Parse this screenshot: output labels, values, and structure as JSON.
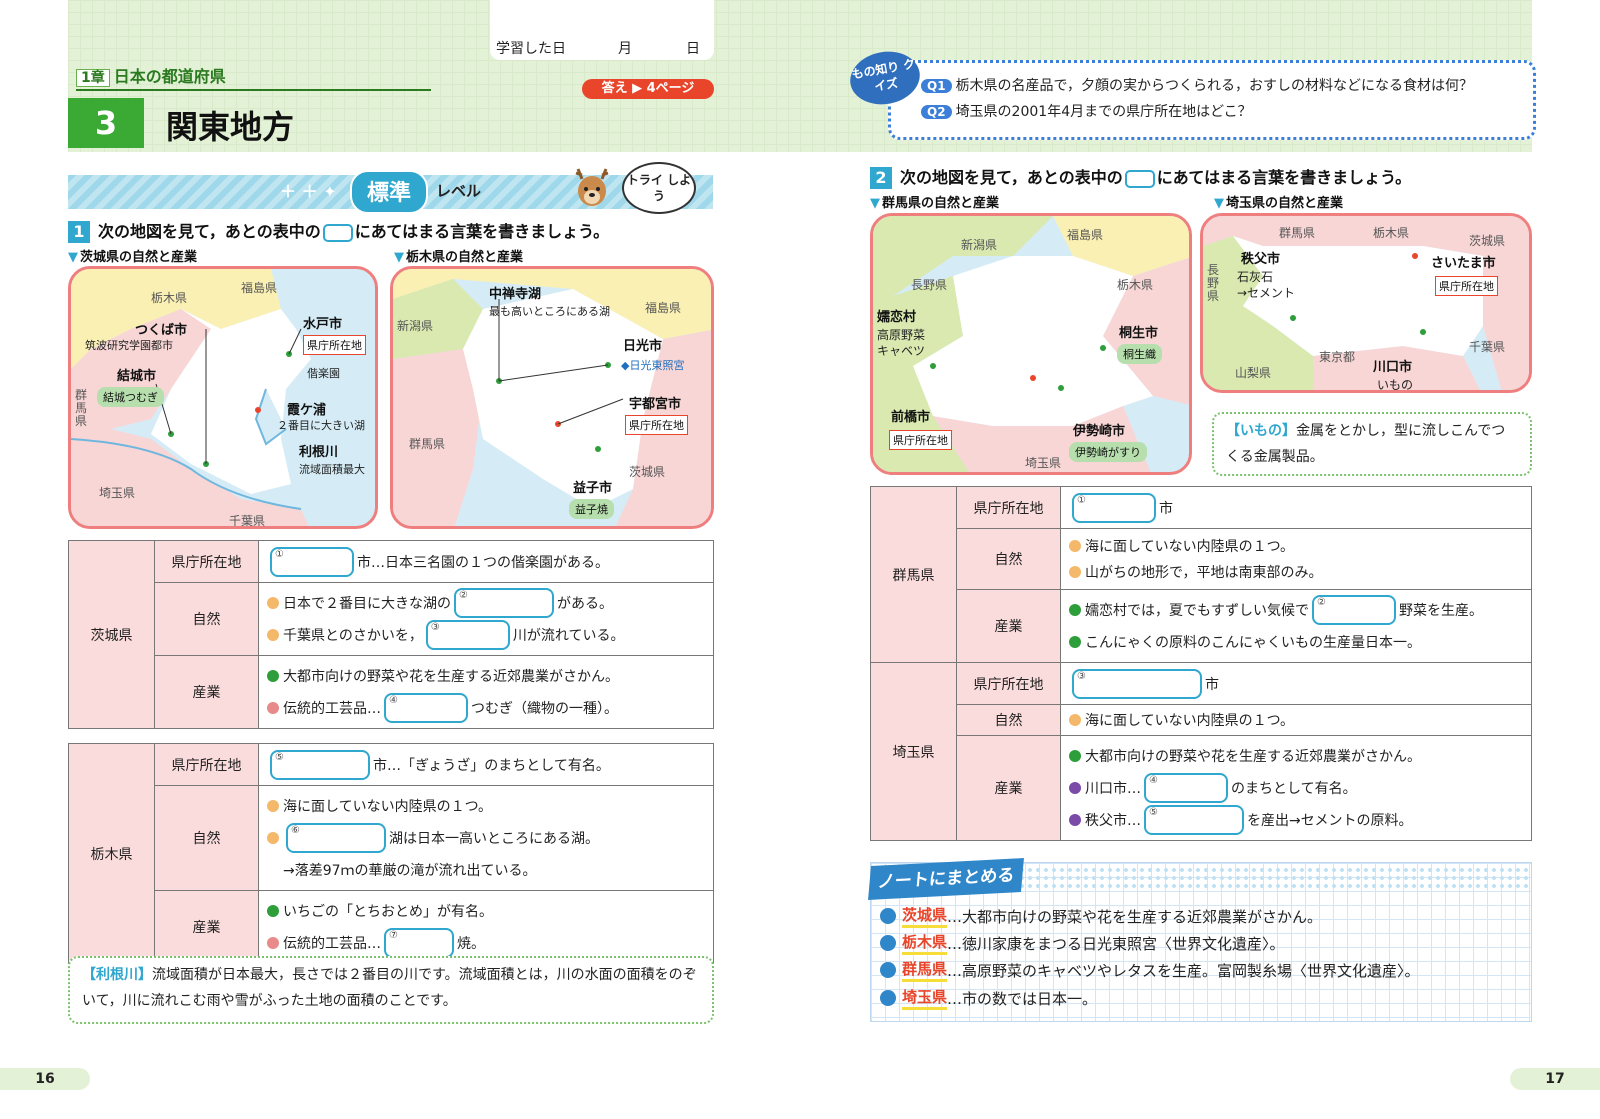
{
  "header": {
    "date_label": "学習した日",
    "month_label": "月",
    "day_label": "日",
    "chapter_num": "1章",
    "chapter_title": "日本の都道府県",
    "answer_ref": "答え ▶ 4ページ",
    "section_num": "3",
    "section_title": "関東地方"
  },
  "quiz": {
    "badge": "もの知り クイズ",
    "q1_tag": "Q1",
    "q1": "栃木県の名産品で，夕顔の実からつくられる，おすしの材料などになる食材は何？",
    "q2_tag": "Q2",
    "q2": "埼玉県の2001年4月までの県庁所在地はどこ？"
  },
  "level": {
    "std": "標準",
    "word": "レベル",
    "try": "トライ しよう"
  },
  "left": {
    "q1_num": "1",
    "q1_text_a": "次の地図を見て，あとの表中の",
    "q1_text_b": "にあてはまる言葉を書きましょう。",
    "map1_caption": "茨城県の自然と産業",
    "map2_caption": "栃木県の自然と産業",
    "map1": {
      "tochigi": "栃木県",
      "fukushima": "福島県",
      "gunma": "群馬県",
      "saitama": "埼玉県",
      "chiba": "千葉県",
      "tsukuba": "つくば市",
      "tsukuba_note": "筑波研究学園都市",
      "yuki": "結城市",
      "yuki_tag": "結城つむぎ",
      "mito": "水戸市",
      "mito_tag": "県庁所在地",
      "kairakuen": "偕楽園",
      "kasumi": "霞ケ浦",
      "kasumi_note": "２番目に大きい湖",
      "tone": "利根川",
      "tone_note": "流域面積最大"
    },
    "map2": {
      "fukushima": "福島県",
      "niigata": "新潟県",
      "gunma": "群馬県",
      "ibaraki": "茨城県",
      "chuzenji": "中禅寺湖",
      "chuzenji_note": "最も高いところにある湖",
      "nikko": "日光市",
      "nikko_note": "◆日光東照宮",
      "utsunomiya": "宇都宮市",
      "utsu_tag": "県庁所在地",
      "mashiko": "益子市",
      "mashiko_tag": "益子焼"
    },
    "ibaraki": {
      "pref": "茨城県",
      "cat_capital": "県庁所在地",
      "cat_nature": "自然",
      "cat_industry": "産業",
      "cap_no": "①",
      "cap_after": "市…日本三名園の１つの偕楽園がある。",
      "n1_a": "日本で２番目に大きな湖の",
      "n1_no": "②",
      "n1_b": "がある。",
      "n2_a": "千葉県とのさかいを，",
      "n2_no": "③",
      "n2_b": "川が流れている。",
      "i1": "大都市向けの野菜や花を生産する近郊農業がさかん。",
      "i2_a": "伝統的工芸品…",
      "i2_no": "④",
      "i2_b": "つむぎ（織物の一種）。"
    },
    "tochigi": {
      "pref": "栃木県",
      "cat_capital": "県庁所在地",
      "cat_nature": "自然",
      "cat_industry": "産業",
      "cap_no": "⑤",
      "cap_after": "市…「ぎょうざ」のまちとして有名。",
      "n1": "海に面していない内陸県の１つ。",
      "n2_no": "⑥",
      "n2_b": "湖は日本一高いところにある湖。",
      "n3": "→落差97ｍの華厳の滝が流れ出ている。",
      "i1": "いちごの「とちおとめ」が有名。",
      "i2_a": "伝統的工芸品…",
      "i2_no": "⑦",
      "i2_b": "焼。"
    },
    "note_key": "【利根川】",
    "note_text": "流域面積が日本最大，長さでは２番目の川です。流域面積とは，川の水面の面積をのぞいて，川に流れこむ雨や雪がふった土地の面積のことです。",
    "page": "16"
  },
  "right": {
    "q2_num": "2",
    "q2_text_a": "次の地図を見て，あとの表中の",
    "q2_text_b": "にあてはまる言葉を書きましょう。",
    "map3_caption": "群馬県の自然と産業",
    "map4_caption": "埼玉県の自然と産業",
    "map3": {
      "niigata": "新潟県",
      "fukushima": "福島県",
      "nagano": "長野県",
      "tochigi": "栃木県",
      "saitama": "埼玉県",
      "tsumagoi": "嬬恋村",
      "tsumagoi_note1": "高原野菜",
      "tsumagoi_note2": "キャベツ",
      "kiryu": "桐生市",
      "kiryu_tag": "桐生織",
      "maebashi": "前橋市",
      "maebashi_tag": "県庁所在地",
      "isesaki": "伊勢崎市",
      "isesaki_tag": "伊勢崎がすり"
    },
    "map4": {
      "gunma": "群馬県",
      "tochigi": "栃木県",
      "ibaraki": "茨城県",
      "nagano": "長野県",
      "tokyo": "東京都",
      "yamanashi": "山梨県",
      "chiba": "千葉県",
      "chichibu": "秩父市",
      "chichibu_note1": "石灰石",
      "chichibu_note2": "→セメント",
      "saitama": "さいたま市",
      "saitama_tag": "県庁所在地",
      "kawaguchi": "川口市",
      "kawaguchi_note": "いもの"
    },
    "imono_key": "【いもの】",
    "imono_text": "金属をとかし，型に流しこんでつくる金属製品。",
    "gunma": {
      "pref": "群馬県",
      "cat_capital": "県庁所在地",
      "cat_nature": "自然",
      "cat_industry": "産業",
      "cap_no": "①",
      "cap_after": "市",
      "n1": "海に面していない内陸県の１つ。",
      "n2": "山がちの地形で，平地は南東部のみ。",
      "i1_a": "嬬恋村では，夏でもすずしい気候で",
      "i1_no": "②",
      "i1_b": "野菜を生産。",
      "i2": "こんにゃくの原料のこんにゃくいもの生産量日本一。"
    },
    "saitama": {
      "pref": "埼玉県",
      "cat_capital": "県庁所在地",
      "cat_nature": "自然",
      "cat_industry": "産業",
      "cap_no": "③",
      "cap_after": "市",
      "n1": "海に面していない内陸県の１つ。",
      "i1": "大都市向けの野菜や花を生産する近郊農業がさかん。",
      "i2_a": "川口市…",
      "i2_no": "④",
      "i2_b": "のまちとして有名。",
      "i3_a": "秩父市…",
      "i3_no": "⑤",
      "i3_b": "を産出→セメントの原料。"
    },
    "summary": {
      "title": "ノートにまとめる",
      "l1_pref": "茨城県",
      "l1": "…大都市向けの野菜や花を生産する近郊農業がさかん。",
      "l2_pref": "栃木県",
      "l2": "…徳川家康をまつる日光東照宮〈世界文化遺産〉。",
      "l3_pref": "群馬県",
      "l3": "…高原野菜のキャベツやレタスを生産。富岡製糸場〈世界文化遺産〉。",
      "l4_pref": "埼玉県",
      "l4": "…市の数では日本一。"
    },
    "page": "17"
  }
}
